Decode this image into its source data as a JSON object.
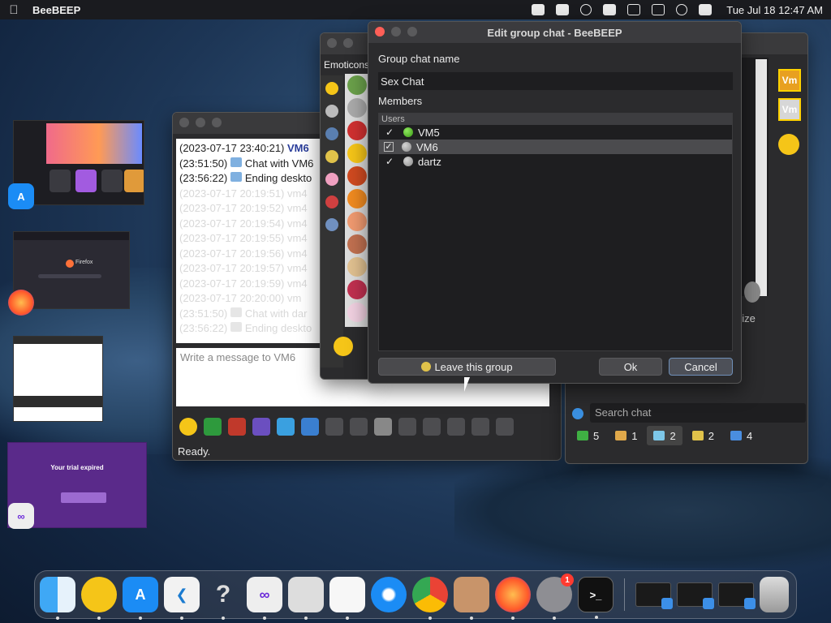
{
  "menubar": {
    "app_name": "BeeBEEP",
    "clock": "Tue Jul 18  12:47 AM"
  },
  "chat_window": {
    "log": [
      {
        "time": "(2023-07-17 23:40:21)",
        "who": "VM6",
        "faded": false
      },
      {
        "time": "(23:51:50)",
        "text": "Chat with VM6",
        "faded": false
      },
      {
        "time": "(23:56:22)",
        "text": "Ending deskto",
        "faded": false
      },
      {
        "time": "(2023-07-17 20:19:51)",
        "who": "vm4",
        "faded": true
      },
      {
        "time": "(2023-07-17 20:19:52)",
        "who": "vm4",
        "faded": true
      },
      {
        "time": "(2023-07-17 20:19:54)",
        "who": "vm4",
        "faded": true
      },
      {
        "time": "(2023-07-17 20:19:55)",
        "who": "vm4",
        "faded": true
      },
      {
        "time": "(2023-07-17 20:19:56)",
        "who": "vm4",
        "faded": true
      },
      {
        "time": "(2023-07-17 20:19:57)",
        "who": "vm4",
        "faded": true
      },
      {
        "time": "(2023-07-17 20:19:59)",
        "who": "vm4",
        "faded": true
      },
      {
        "time": "(2023-07-17 20:20:00)",
        "who": "vm",
        "faded": true
      },
      {
        "time": "(23:51:50)",
        "text": "Chat with dar",
        "faded": true
      },
      {
        "time": "(23:56:22)",
        "text": "Ending deskto",
        "faded": true
      }
    ],
    "message_placeholder": "Write a message to VM6",
    "status": "Ready."
  },
  "emoticons": {
    "tab_label": "Emoticons"
  },
  "right_window": {
    "search_placeholder": "Search chat",
    "minimize_label": "nize",
    "vm_badge": "Vm",
    "tabs": [
      {
        "count": "5",
        "color": "#3fb043"
      },
      {
        "count": "1",
        "color": "#e0a84a"
      },
      {
        "count": "2",
        "color": "#7dc7e8"
      },
      {
        "count": "2",
        "color": "#e0c24a"
      },
      {
        "count": "4",
        "color": "#4a8ee0"
      }
    ]
  },
  "dialog": {
    "title": "Edit group chat - BeeBEEP",
    "name_label": "Group chat name",
    "name_value": "Sex Chat",
    "members_label": "Members",
    "members_header": "Users",
    "members": [
      {
        "name": "VM5",
        "checked": true,
        "online": true,
        "selected": false
      },
      {
        "name": "VM6",
        "checked": true,
        "online": false,
        "selected": true
      },
      {
        "name": "dartz",
        "checked": true,
        "online": false,
        "selected": false
      }
    ],
    "leave_label": "Leave this group",
    "ok_label": "Ok",
    "cancel_label": "Cancel"
  },
  "thumbnails": {
    "firefox_label": "Firefox",
    "vs_title": "Your trial expired"
  },
  "dock": {
    "settings_badge": "1"
  }
}
